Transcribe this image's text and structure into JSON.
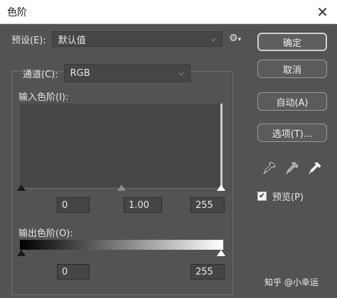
{
  "window": {
    "title": "色阶",
    "close_glyph": "✕"
  },
  "preset": {
    "label": "预设(E):",
    "value": "默认值",
    "menu_icon": "gear-icon"
  },
  "channel": {
    "label": "通道(C):",
    "value": "RGB"
  },
  "input_levels": {
    "label": "输入色阶(I):",
    "black": "0",
    "gamma": "1.00",
    "white": "255"
  },
  "output_levels": {
    "label": "输出色阶(O):",
    "black": "0",
    "white": "255"
  },
  "buttons": {
    "ok": "确定",
    "cancel": "取消",
    "auto": "自动(A)",
    "options": "选项(T)..."
  },
  "eyedroppers": [
    "black-point-eyedropper-icon",
    "gray-point-eyedropper-icon",
    "white-point-eyedropper-icon"
  ],
  "preview": {
    "label": "预览(P)",
    "checked": true,
    "check_glyph": "✔"
  },
  "watermark": "知乎 @小幸运",
  "colors": {
    "dialog_bg": "#535353",
    "field_bg": "#464646",
    "titlebar_bg": "#ffffff"
  }
}
